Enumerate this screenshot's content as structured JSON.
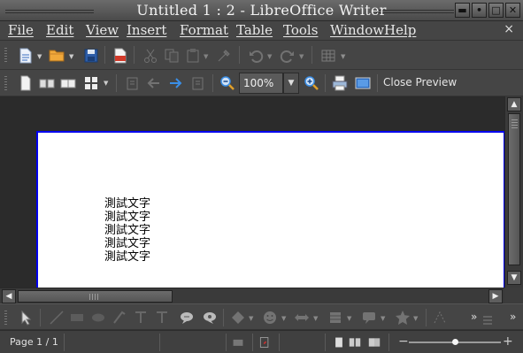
{
  "window": {
    "title": "Untitled 1 : 2 - LibreOffice Writer"
  },
  "menubar": {
    "items": [
      "File",
      "Edit",
      "View",
      "Insert",
      "Format",
      "Table",
      "Tools",
      "Window",
      "Help"
    ],
    "close_glyph": "×"
  },
  "standard_toolbar": {
    "icons": [
      "new-document-icon",
      "open-folder-icon",
      "save-icon",
      "export-pdf-icon",
      "cut-icon",
      "copy-icon",
      "paste-icon",
      "clone-formatting-icon",
      "undo-icon",
      "redo-icon",
      "insert-table-icon"
    ]
  },
  "preview_toolbar": {
    "zoom_value": "100%",
    "close_preview_label": "Close Preview",
    "icons": [
      "single-page-icon",
      "two-pages-icon",
      "book-view-icon",
      "multiple-pages-icon",
      "first-page-icon",
      "previous-page-icon",
      "next-page-icon",
      "last-page-icon",
      "zoom-out-icon",
      "zoom-in-icon",
      "print-icon",
      "fullscreen-icon"
    ]
  },
  "document": {
    "lines": [
      "測試文字",
      "測試文字",
      "測試文字",
      "測試文字",
      "測試文字"
    ]
  },
  "drawing_toolbar": {
    "icons": [
      "select-icon",
      "line-icon",
      "rectangle-icon",
      "ellipse-icon",
      "freeform-line-icon",
      "text-icon",
      "callout-icon",
      "comment-icon",
      "basic-shapes-icon",
      "symbol-shapes-icon",
      "block-arrows-icon",
      "flowchart-icon",
      "callouts-icon",
      "stars-icon",
      "points-icon",
      "more-icon"
    ]
  },
  "statusbar": {
    "page_count": "Page 1 / 1",
    "zoom_slider_level": 0.5,
    "zoom_minus": "−",
    "zoom_plus": "+"
  },
  "colors": {
    "page_border": "#0000ee",
    "accent_blue": "#3a8ee6"
  }
}
